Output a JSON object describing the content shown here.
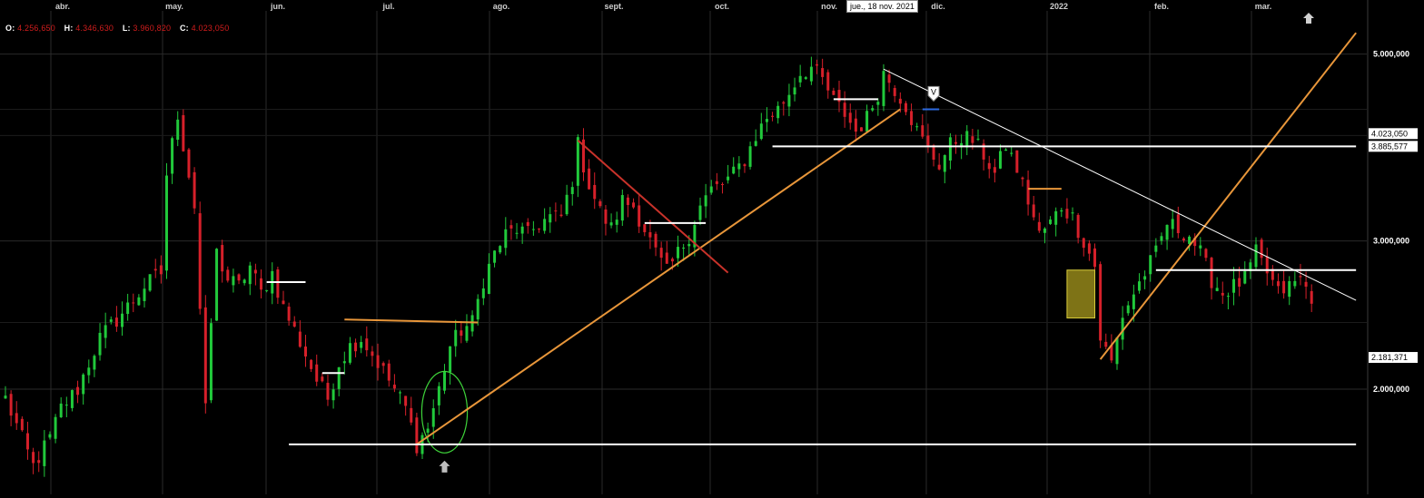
{
  "ohlc": {
    "o_label": "O:",
    "o": "4.256,650",
    "h_label": "H:",
    "h": "4.346,630",
    "l_label": "L:",
    "l": "3.960,820",
    "c_label": "C:",
    "c": "4.023,050"
  },
  "crosshair_date": "jue., 18 nov. 2021",
  "colors": {
    "background": "#000000",
    "grid": "#2a2a2a",
    "up": "#21c93b",
    "down": "#d6202a",
    "trend_orange": "#e8963a",
    "trend_white": "#ffffff",
    "box_fill": "#a89a1e"
  },
  "icons": [
    "scroll-up-icon",
    "arrow-up-marker-icon",
    "v-marker-icon"
  ],
  "chart_data": {
    "type": "candlestick",
    "y_scale": "log",
    "ylim": [
      1500000,
      5600000
    ],
    "months": [
      "abr.",
      "may.",
      "jun.",
      "jul.",
      "ago.",
      "sept.",
      "oct.",
      "nov.",
      "dic.",
      "2022",
      "feb.",
      "mar."
    ],
    "y_ticks": [
      {
        "value": 5000000,
        "label": "5.000,000"
      },
      {
        "value": 3000000,
        "label": "3.000,000"
      },
      {
        "value": 2000000,
        "label": "2.000,000"
      }
    ],
    "price_tags": [
      {
        "value": 4023050,
        "label": "4.023,050",
        "style": "current"
      },
      {
        "value": 3885577,
        "label": "3.885,577",
        "style": "level"
      },
      {
        "value": 2181371,
        "label": "2.181,371",
        "style": "level"
      }
    ],
    "path": [
      [
        0,
        1950000
      ],
      [
        5,
        1620000
      ],
      [
        8,
        1750000
      ],
      [
        10,
        1900000
      ],
      [
        13,
        2000000
      ],
      [
        15,
        2150000
      ],
      [
        17,
        2300000
      ],
      [
        20,
        2420000
      ],
      [
        23,
        2550000
      ],
      [
        25,
        2650000
      ],
      [
        28,
        2750000
      ],
      [
        29,
        3600000
      ],
      [
        31,
        4250000
      ],
      [
        32,
        3900000
      ],
      [
        33,
        3600000
      ],
      [
        34,
        3300000
      ],
      [
        36,
        1880000
      ],
      [
        37,
        2400000
      ],
      [
        38,
        2900000
      ],
      [
        40,
        2700000
      ],
      [
        42,
        2650000
      ],
      [
        44,
        2800000
      ],
      [
        46,
        2600000
      ],
      [
        48,
        2750000
      ],
      [
        50,
        2500000
      ],
      [
        52,
        2350000
      ],
      [
        54,
        2200000
      ],
      [
        56,
        2050000
      ],
      [
        58,
        1950000
      ],
      [
        60,
        2150000
      ],
      [
        62,
        2250000
      ],
      [
        64,
        2300000
      ],
      [
        66,
        2200000
      ],
      [
        68,
        2100000
      ],
      [
        70,
        2000000
      ],
      [
        72,
        1900000
      ],
      [
        74,
        1720000
      ],
      [
        76,
        1800000
      ],
      [
        78,
        2000000
      ],
      [
        80,
        2250000
      ],
      [
        82,
        2350000
      ],
      [
        84,
        2400000
      ],
      [
        86,
        2700000
      ],
      [
        88,
        2900000
      ],
      [
        90,
        3050000
      ],
      [
        92,
        3100000
      ],
      [
        94,
        3050000
      ],
      [
        96,
        3150000
      ],
      [
        98,
        3200000
      ],
      [
        100,
        3200000
      ],
      [
        102,
        3550000
      ],
      [
        103,
        3900000
      ],
      [
        105,
        3500000
      ],
      [
        107,
        3250000
      ],
      [
        109,
        3100000
      ],
      [
        111,
        3350000
      ],
      [
        113,
        3300000
      ],
      [
        115,
        3100000
      ],
      [
        117,
        2900000
      ],
      [
        119,
        2750000
      ],
      [
        121,
        2900000
      ],
      [
        123,
        3050000
      ],
      [
        125,
        3300000
      ],
      [
        127,
        3450000
      ],
      [
        129,
        3500000
      ],
      [
        131,
        3600000
      ],
      [
        133,
        3750000
      ],
      [
        135,
        4000000
      ],
      [
        137,
        4200000
      ],
      [
        139,
        4300000
      ],
      [
        141,
        4500000
      ],
      [
        143,
        4750000
      ],
      [
        145,
        4820000
      ],
      [
        147,
        4650000
      ],
      [
        149,
        4400000
      ],
      [
        151,
        4250000
      ],
      [
        153,
        4050000
      ],
      [
        155,
        4200000
      ],
      [
        157,
        4500000
      ],
      [
        158,
        4750000
      ],
      [
        160,
        4550000
      ],
      [
        162,
        4350000
      ],
      [
        164,
        4050000
      ],
      [
        166,
        3850000
      ],
      [
        168,
        3700000
      ],
      [
        170,
        3900000
      ],
      [
        172,
        4000000
      ],
      [
        174,
        3950000
      ],
      [
        176,
        3800000
      ],
      [
        178,
        3600000
      ],
      [
        180,
        3900000
      ],
      [
        182,
        3650000
      ],
      [
        184,
        3350000
      ],
      [
        186,
        3050000
      ],
      [
        188,
        3150000
      ],
      [
        190,
        3300000
      ],
      [
        192,
        3200000
      ],
      [
        194,
        3000000
      ],
      [
        196,
        2800000
      ],
      [
        197,
        2300000
      ],
      [
        199,
        2150000
      ],
      [
        201,
        2450000
      ],
      [
        203,
        2600000
      ],
      [
        205,
        2750000
      ],
      [
        207,
        2900000
      ],
      [
        209,
        3150000
      ],
      [
        211,
        3100000
      ],
      [
        213,
        3050000
      ],
      [
        215,
        2900000
      ],
      [
        217,
        2700000
      ],
      [
        219,
        2600000
      ],
      [
        221,
        2650000
      ],
      [
        223,
        2700000
      ],
      [
        225,
        2900000
      ],
      [
        227,
        2750000
      ],
      [
        229,
        2600000
      ],
      [
        231,
        2650000
      ],
      [
        233,
        2700000
      ],
      [
        235,
        2580000
      ]
    ],
    "trendlines": [
      {
        "color": "orange",
        "from": [
          74,
          1720000
        ],
        "to": [
          161,
          4300000
        ]
      },
      {
        "color": "orange",
        "from": [
          197,
          2170000
        ],
        "to": [
          243,
          5300000
        ]
      },
      {
        "color": "orange",
        "from": [
          61,
          2420000
        ],
        "to": [
          85,
          2400000
        ]
      },
      {
        "color": "red",
        "from": [
          103,
          3950000
        ],
        "to": [
          130,
          2750000
        ]
      },
      {
        "color": "white",
        "from": [
          158,
          4800000
        ],
        "to": [
          243,
          2550000
        ]
      },
      {
        "color": "white",
        "from": [
          138,
          3885577
        ],
        "to": [
          243,
          3885577
        ]
      },
      {
        "color": "white",
        "from": [
          51,
          1720000
        ],
        "to": [
          243,
          1720000
        ]
      },
      {
        "color": "white",
        "from": [
          207,
          2770000
        ],
        "to": [
          243,
          2770000
        ]
      },
      {
        "color": "white",
        "from": [
          47,
          2680000
        ],
        "to": [
          54,
          2680000
        ]
      },
      {
        "color": "white",
        "from": [
          57,
          2090000
        ],
        "to": [
          61,
          2090000
        ]
      },
      {
        "color": "white",
        "from": [
          115,
          3150000
        ],
        "to": [
          126,
          3150000
        ]
      },
      {
        "color": "white",
        "from": [
          149,
          4420000
        ],
        "to": [
          157,
          4420000
        ]
      },
      {
        "color": "orange",
        "from": [
          184,
          3460000
        ],
        "to": [
          190,
          3460000
        ]
      },
      {
        "color": "blue",
        "from": [
          165,
          4300000
        ],
        "to": [
          168,
          4300000
        ]
      }
    ],
    "box": {
      "x0": 191,
      "x1": 196,
      "y0": 2430000,
      "y1": 2770000
    },
    "ellipse": {
      "cx": 79,
      "cy": 1880000,
      "rx": 4.1,
      "ry_top": 2100000,
      "ry_bottom": 1680000
    },
    "markers": [
      {
        "type": "arrow-up",
        "x": 79,
        "y_below": 1720000
      },
      {
        "type": "v",
        "x": 167,
        "y": 4420000
      }
    ]
  }
}
